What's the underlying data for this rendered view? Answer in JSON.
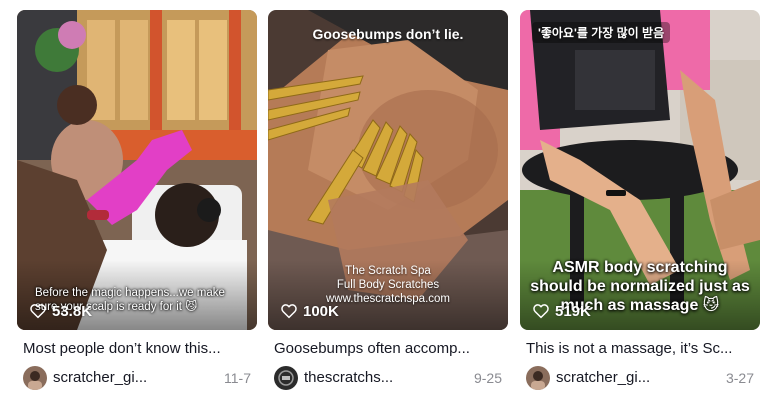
{
  "cards": [
    {
      "views": "53.8K",
      "overlay_caption": "Before the magic happens...we make sure your scalp is ready for it 😼",
      "title": "Most people don’t know this...",
      "author": "scratcher_gi...",
      "date": "11-7"
    },
    {
      "views": "100K",
      "overlay_top": "Goosebumps don’t lie.",
      "overlay_mid_1": "The Scratch Spa",
      "overlay_mid_2": "Full Body Scratches",
      "overlay_mid_3": "www.thescratchspa.com",
      "title": "Goosebumps often accomp...",
      "author": "thescratchs...",
      "date": "9-25"
    },
    {
      "views": "519K",
      "overlay_top": "'좋아요'를 가장 많이 받음",
      "overlay_mid_1": "ASMR body scratching",
      "overlay_mid_2": "should be normalized just as",
      "overlay_mid_3": "much as massage 😼",
      "title": "This is not a massage, it’s Sc...",
      "author": "scratcher_gi...",
      "date": "3-27"
    }
  ],
  "icons": {
    "views": "play-count-heart-icon"
  },
  "colors": {
    "nail_pink": "#e23fc6",
    "gold": "#d4a93a",
    "chair_black": "#1c1c1e",
    "top_pink": "#ee6aa8",
    "grass": "#5f8a3c"
  }
}
